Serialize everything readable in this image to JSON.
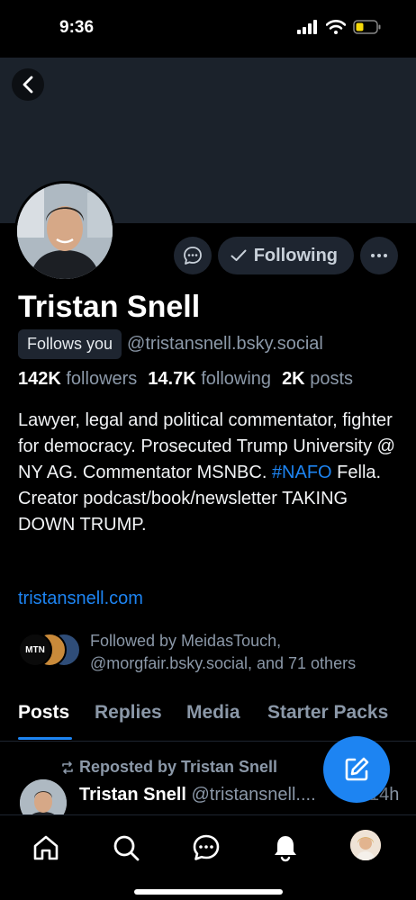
{
  "status": {
    "time": "9:36"
  },
  "profile": {
    "name": "Tristan Snell",
    "follows_you": "Follows you",
    "handle": "@tristansnell.bsky.social",
    "following_label": "Following",
    "stats": {
      "followers_count": "142K",
      "followers_label": "followers",
      "following_count": "14.7K",
      "following_label": "following",
      "posts_count": "2K",
      "posts_label": "posts"
    },
    "bio_before_tag": "Lawyer, legal and political commentator, fighter for democracy. Prosecuted Trump University @ NY AG. Commentator MSNBC. ",
    "bio_tag": "#NAFO",
    "bio_after_tag": " Fella. Creator podcast/book/newsletter TAKING DOWN TRUMP.",
    "website": "tristansnell.com",
    "followed_by": "Followed by MeidasTouch, @morgfair.bsky.social, and 71 others",
    "followed_by_avatar_text": "MTN"
  },
  "tabs": [
    {
      "label": "Posts"
    },
    {
      "label": "Replies"
    },
    {
      "label": "Media"
    },
    {
      "label": "Starter Packs"
    }
  ],
  "post": {
    "repost_label": "Reposted by Tristan Snell",
    "author": "Tristan Snell",
    "handle": "@tristansnell....",
    "time": "14h"
  },
  "colors": {
    "accent": "#1d84f2",
    "banner": "#1b222b",
    "muted": "#8b98a8"
  }
}
